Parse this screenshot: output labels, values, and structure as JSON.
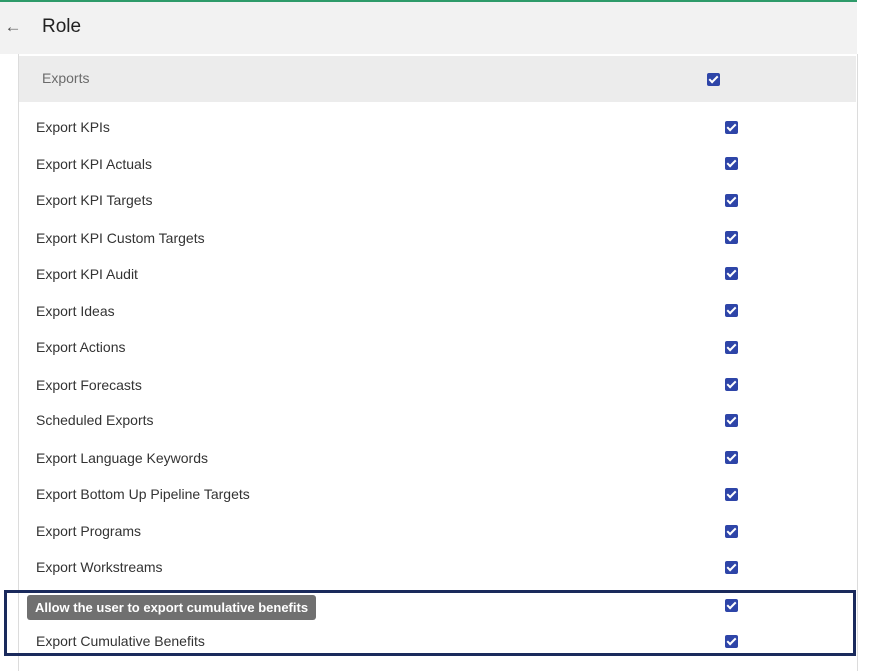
{
  "header": {
    "title": "Role"
  },
  "section": {
    "label": "Exports",
    "checked": true
  },
  "rows": [
    {
      "label": "Export KPIs",
      "checked": true
    },
    {
      "label": "Export KPI Actuals",
      "checked": true
    },
    {
      "label": "Export KPI Targets",
      "checked": true
    },
    {
      "label": "Export KPI Custom Targets",
      "checked": true
    },
    {
      "label": "Export KPI Audit",
      "checked": true
    },
    {
      "label": "Export Ideas",
      "checked": true
    },
    {
      "label": "Export Actions",
      "checked": true
    },
    {
      "label": "Export Forecasts",
      "checked": true
    },
    {
      "label": "Scheduled Exports",
      "checked": true
    },
    {
      "label": "Export Language Keywords",
      "checked": true
    },
    {
      "label": "Export Bottom Up Pipeline Targets",
      "checked": true
    },
    {
      "label": "Export Programs",
      "checked": true
    },
    {
      "label": "Export Workstreams",
      "checked": true
    },
    {
      "label": "",
      "checked": true
    },
    {
      "label": "Export Cumulative Benefits",
      "checked": true
    }
  ],
  "tooltip": {
    "text": "Allow the user to export cumulative benefits"
  },
  "colors": {
    "accent": "#2e45a8",
    "top_bar": "#2e9b6a",
    "highlight_border": "#1a2a5c"
  }
}
